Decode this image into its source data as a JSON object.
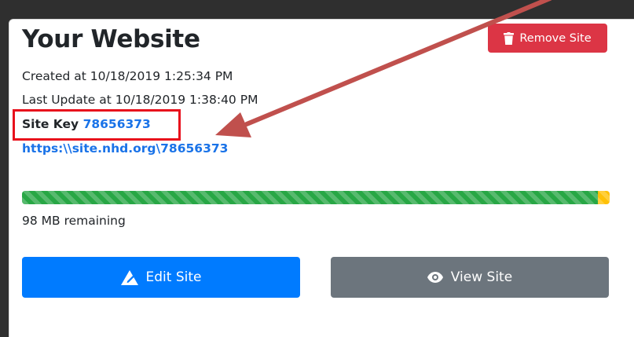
{
  "site": {
    "title": "Your Website",
    "remove_label": "Remove Site",
    "created": "Created at 10/18/2019 1:25:34 PM",
    "updated": "Last Update at 10/18/2019 1:38:40 PM",
    "key_label": "Site Key",
    "key_value": "78656373",
    "url": "https:\\\\site.nhd.org\\78656373",
    "storage": {
      "used_fraction": 0.98,
      "remaining_text": "98 MB remaining"
    },
    "edit_label": "Edit Site",
    "view_label": "View Site"
  },
  "colors": {
    "danger": "#dc3545",
    "primary": "#007bff",
    "secondary": "#6c757d",
    "progress_used": "#28a745",
    "progress_warn": "#ffc107",
    "annotation": "#c0504d",
    "highlight": "#e8101c"
  },
  "icons": {
    "remove": "trash-icon",
    "edit": "edit-site-icon",
    "view": "eye-icon"
  }
}
